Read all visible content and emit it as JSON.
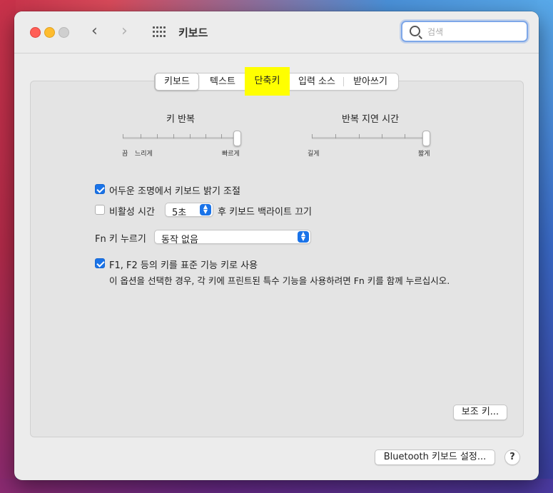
{
  "window": {
    "title": "키보드"
  },
  "search": {
    "placeholder": "검색"
  },
  "tabs": [
    {
      "label": "키보드"
    },
    {
      "label": "텍스트"
    },
    {
      "label": "단축키"
    },
    {
      "label": "입력 소스"
    },
    {
      "label": "받아쓰기"
    }
  ],
  "key_repeat": {
    "title": "키 반복",
    "min_label": "끔",
    "slow_label": "느리게",
    "fast_label": "빠르게",
    "level": 1.0
  },
  "delay_until_repeat": {
    "title": "반복 지연 시간",
    "long_label": "길게",
    "short_label": "짧게",
    "level": 1.0
  },
  "options": {
    "adjust_brightness": {
      "label": "어두운 조명에서 키보드 밝기 조절",
      "checked": true
    },
    "backlight_off": {
      "label_before": "비활성 시간",
      "value": "5초",
      "label_after": "후 키보드 백라이트 끄기",
      "checked": false
    },
    "fn_key": {
      "label": "Fn 키 누르기",
      "value": "동작 없음"
    },
    "function_keys": {
      "label": "F1, F2 등의 키를 표준 기능 키로 사용",
      "description": "이 옵션을 선택한 경우, 각 키에 프린트된 특수 기능을 사용하려면 Fn 키를 함께 누르십시오.",
      "checked": true
    }
  },
  "buttons": {
    "modifier_keys": "보조 키...",
    "bluetooth_setup": "Bluetooth 키보드 설정...",
    "help": "?"
  },
  "colors": {
    "highlight": "#ffff00",
    "accent": "#1a73e8"
  }
}
